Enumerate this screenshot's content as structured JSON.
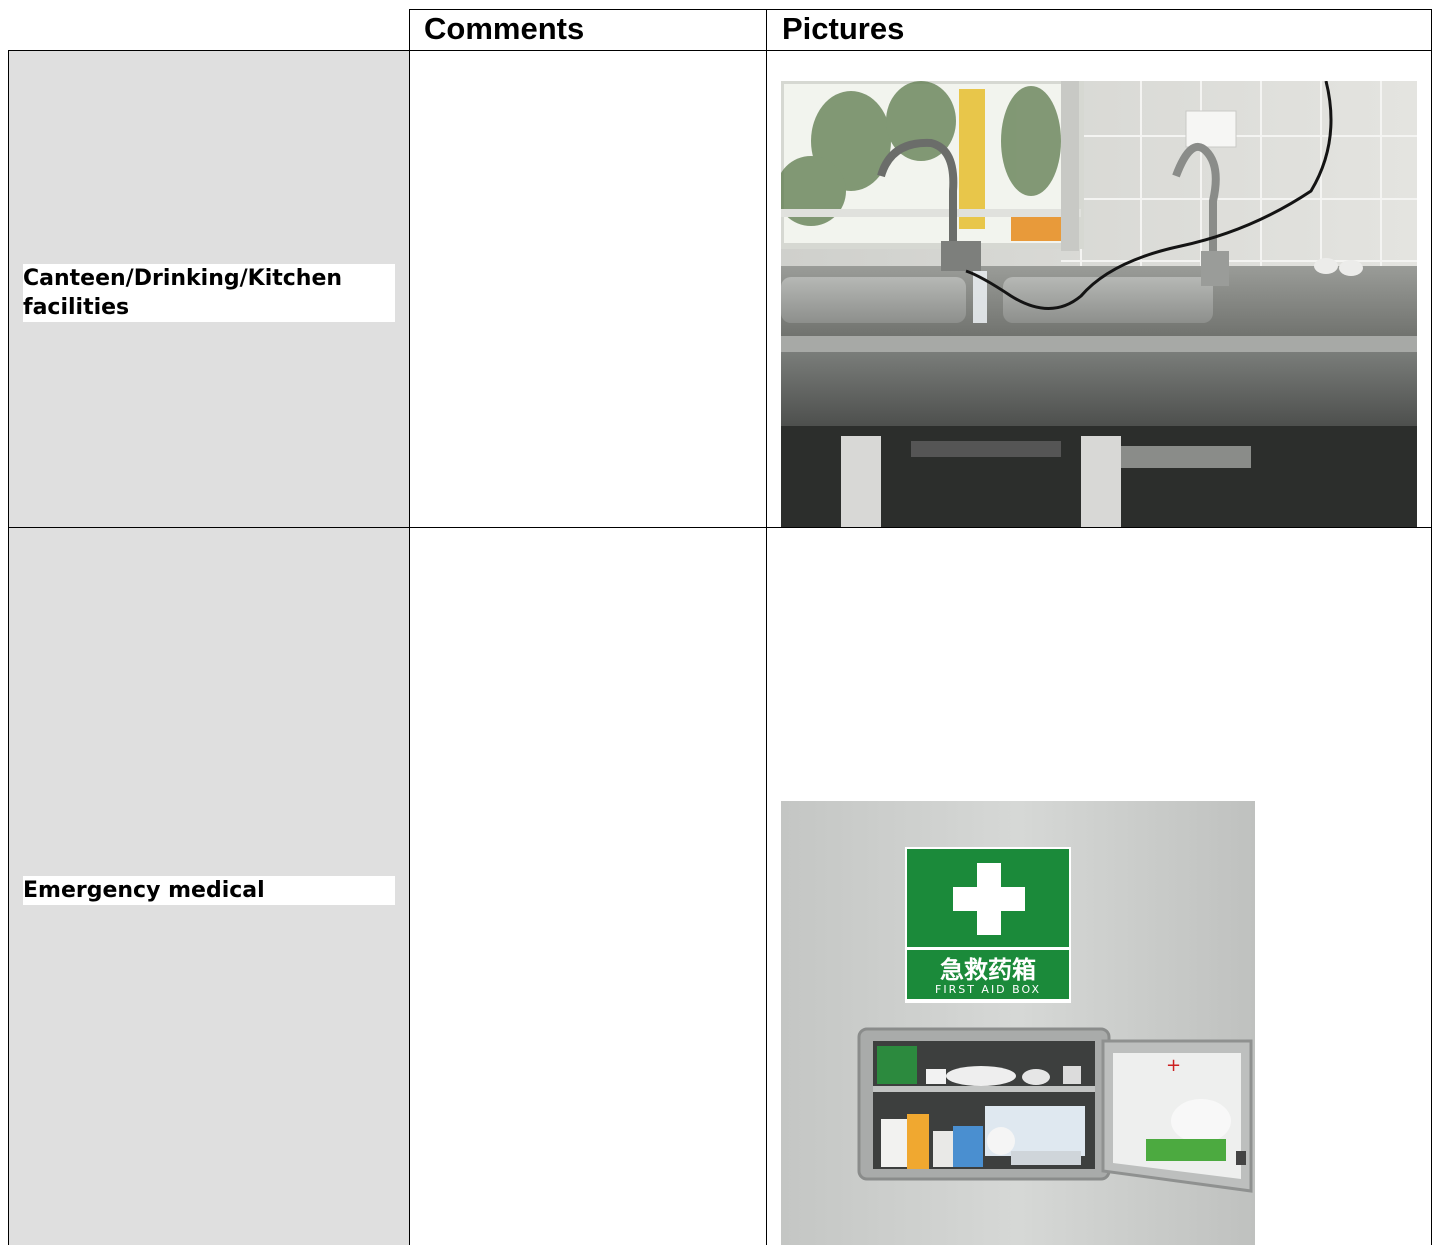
{
  "table": {
    "headers": {
      "comments": "Comments",
      "pictures": "Pictures"
    },
    "rows": [
      {
        "label_line1": "Canteen/Drinking/Kitchen",
        "label_line2": "facilities",
        "comment": "",
        "picture_icon": "kitchen-sink-photo"
      },
      {
        "label_line1": "Emergency medical",
        "comment": "",
        "picture_icon": "first-aid-box-photo",
        "sign_cn": "急救药箱",
        "sign_en": "FIRST AID BOX"
      }
    ]
  },
  "colors": {
    "label_bg": "#dfdfdf",
    "border": "#000000",
    "sign_green": "#1a8f3a"
  }
}
